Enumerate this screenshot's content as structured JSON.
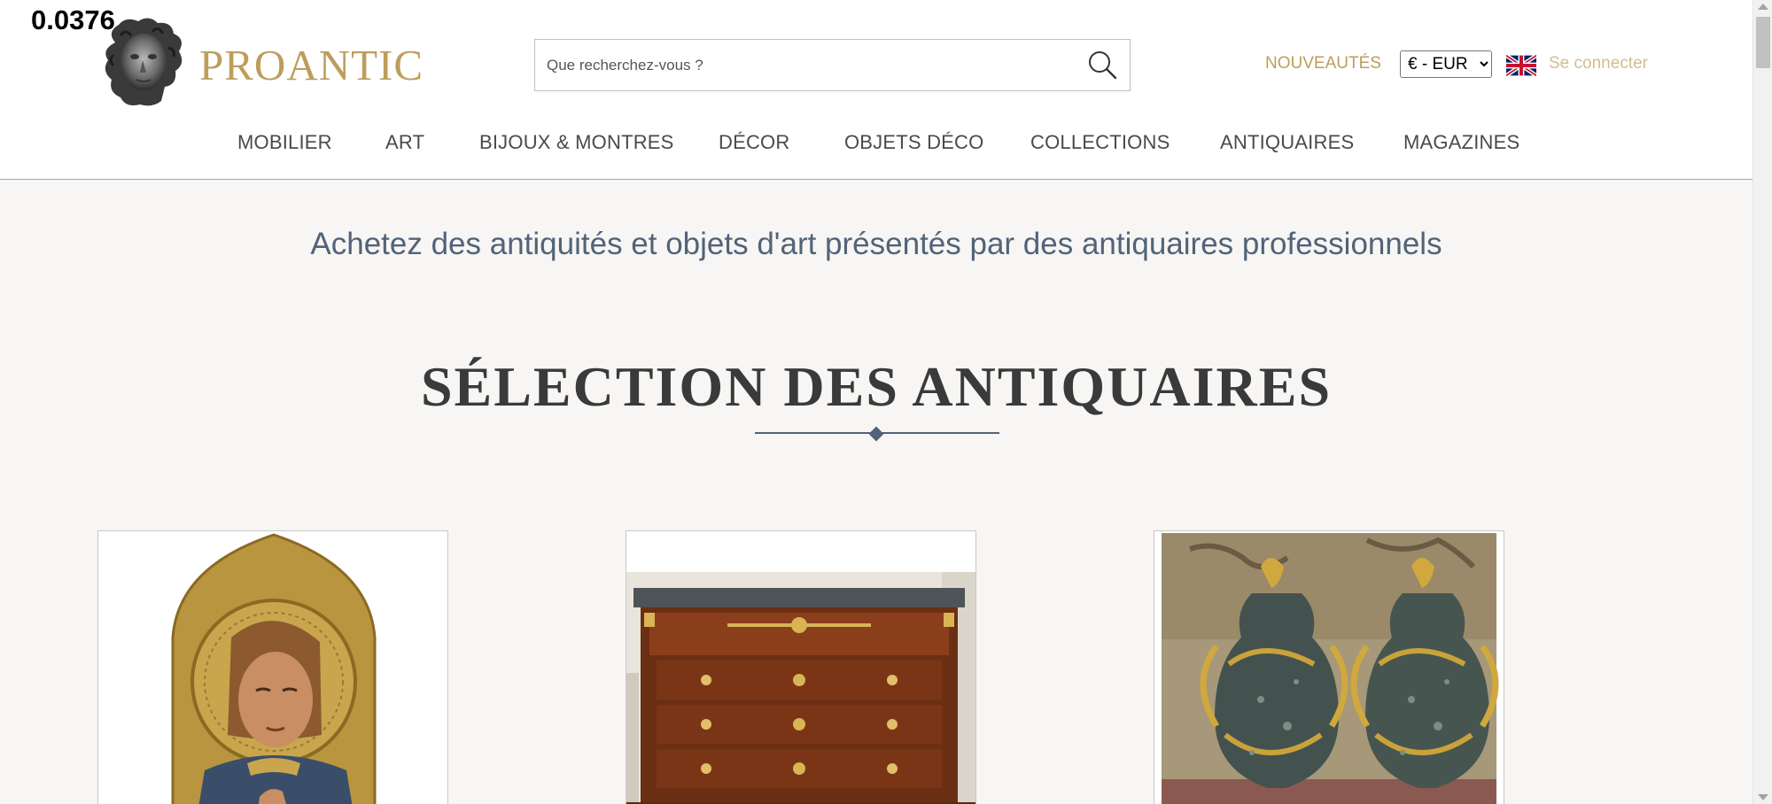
{
  "overlay": {
    "value": "0.0376"
  },
  "header": {
    "logo_icon": "medusa-head-logo",
    "brand": "PROANTIC",
    "search": {
      "placeholder": "Que recherchez-vous ?",
      "value": "",
      "icon": "search-icon"
    },
    "nouveautes_label": "NOUVEAUTÉS",
    "currency": {
      "selected": "€ - EUR",
      "options": [
        "€ - EUR"
      ]
    },
    "flag_icon": "uk-flag-icon",
    "login_label": "Se connecter"
  },
  "nav": {
    "items": [
      {
        "label": "MOBILIER"
      },
      {
        "label": "ART"
      },
      {
        "label": "BIJOUX & MONTRES"
      },
      {
        "label": "DÉCOR"
      },
      {
        "label": "OBJETS DÉCO"
      },
      {
        "label": "COLLECTIONS"
      },
      {
        "label": "ANTIQUAIRES"
      },
      {
        "label": "MAGAZINES"
      }
    ]
  },
  "main": {
    "tagline": "Achetez des antiquités et objets d'art présentés par des antiquaires professionnels",
    "section_title": "SÉLECTION DES ANTIQUAIRES",
    "cards": [
      {
        "image": "gothic-saint-painting"
      },
      {
        "image": "empire-mahogany-commode"
      },
      {
        "image": "pair-of-marble-ormolu-vases"
      }
    ]
  },
  "colors": {
    "brand_gold": "#bd9d5c",
    "login_gold": "#d4bd8e",
    "tagline_blue": "#526379",
    "page_bg": "#f7f6f4"
  }
}
